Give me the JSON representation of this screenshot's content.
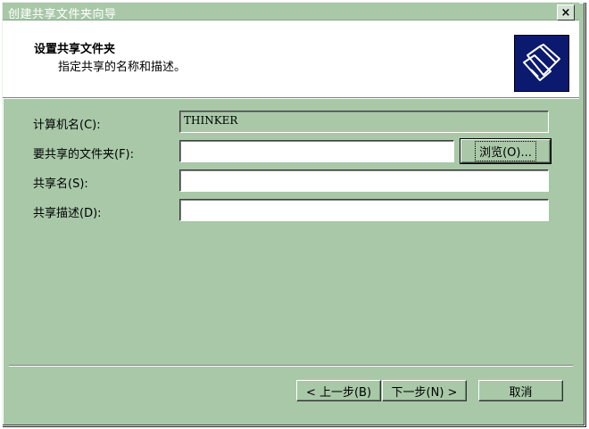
{
  "window": {
    "title": "创建共享文件夹向导",
    "close_label": "×"
  },
  "header": {
    "title": "设置共享文件夹",
    "subtitle": "指定共享的名称和描述。",
    "icon": "shared-folder-icon"
  },
  "form": {
    "computer_name": {
      "label": "计算机名(C):",
      "value": "THINKER"
    },
    "folder": {
      "label": "要共享的文件夹(F):",
      "value": ""
    },
    "share_name": {
      "label": "共享名(S):",
      "value": ""
    },
    "description": {
      "label": "共享描述(D):",
      "value": ""
    },
    "browse_label": "浏览(O)..."
  },
  "buttons": {
    "back": "< 上一步(B)",
    "next": "下一步(N) >",
    "cancel": "取消"
  },
  "colors": {
    "background": "#a8c8a8",
    "header_bg": "#ffffff",
    "icon_bg": "#0b1a6e"
  }
}
